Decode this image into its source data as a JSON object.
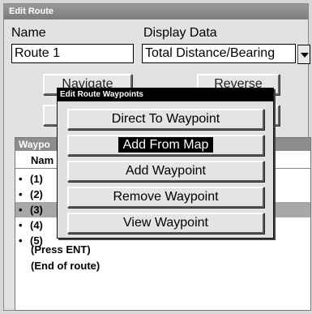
{
  "window": {
    "title": "Edit Route"
  },
  "name": {
    "label": "Name",
    "value": "Route 1"
  },
  "display": {
    "label": "Display Data",
    "value": "Total Distance/Bearing"
  },
  "background_buttons": {
    "navigate": "Navigate",
    "reverse": "Reverse"
  },
  "waypoints": {
    "header": "Waypo",
    "column": "Nam",
    "rows": [
      {
        "bullet": "•",
        "label": "(1)"
      },
      {
        "bullet": "•",
        "label": "(2)"
      },
      {
        "bullet": "•",
        "label": "(3)"
      },
      {
        "bullet": "•",
        "label": "(4)"
      },
      {
        "bullet": "•",
        "label": "(5)"
      }
    ],
    "press_ent": "(Press ENT)",
    "end_of_route": "(End of route)"
  },
  "popup": {
    "title": "Edit Route Waypoints",
    "items": [
      {
        "label": "Direct To Waypoint"
      },
      {
        "label": "Add From Map"
      },
      {
        "label": "Add Waypoint"
      },
      {
        "label": "Remove Waypoint"
      },
      {
        "label": "View Waypoint"
      }
    ]
  },
  "selected_waypoint_index": 2,
  "active_menu_index": 1
}
